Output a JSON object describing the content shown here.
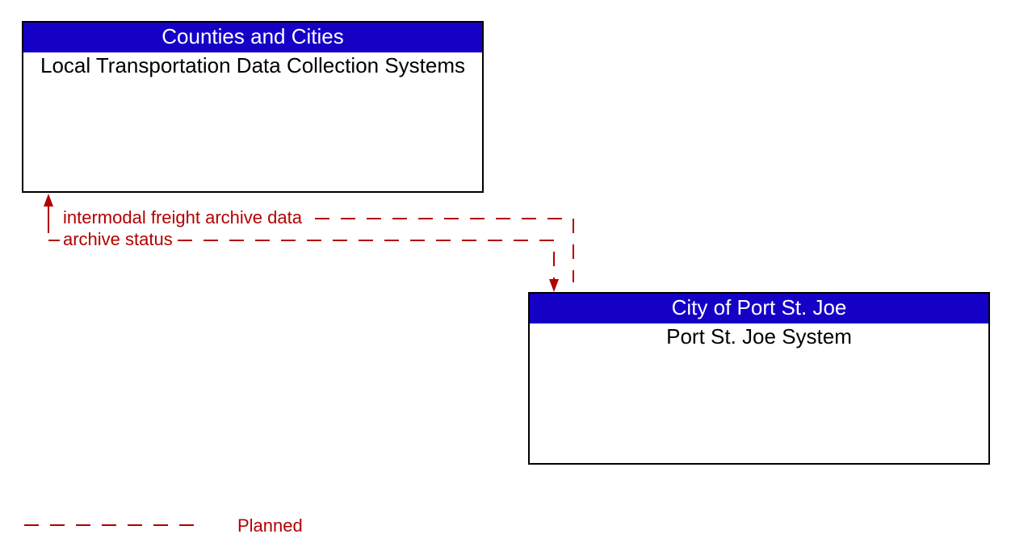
{
  "boxes": {
    "top": {
      "header": "Counties and Cities",
      "body": "Local Transportation Data Collection Systems"
    },
    "bottom": {
      "header": "City of Port St. Joe",
      "body": "Port St. Joe System"
    }
  },
  "flows": {
    "to_top": "intermodal freight archive data",
    "to_bottom": "archive status"
  },
  "legend": {
    "planned": "Planned"
  }
}
